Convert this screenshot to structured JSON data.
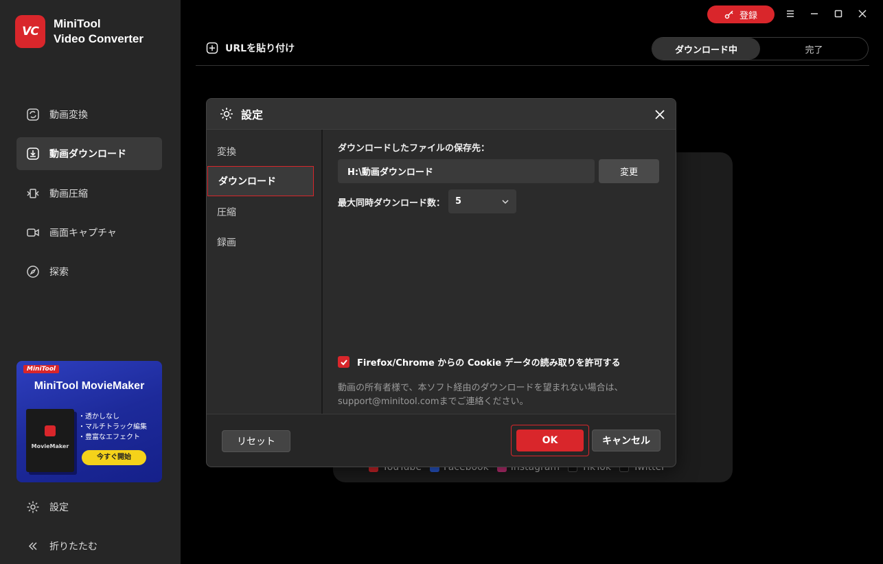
{
  "app": {
    "logo_badge": "VC",
    "logo_line1": "MiniTool",
    "logo_line2": "Video Converter"
  },
  "sidebar": {
    "items": [
      {
        "label": "動画変換",
        "icon": "convert-icon"
      },
      {
        "label": "動画ダウンロード",
        "icon": "download-icon",
        "active": true
      },
      {
        "label": "動画圧縮",
        "icon": "compress-icon"
      },
      {
        "label": "画面キャプチャ",
        "icon": "camera-icon"
      },
      {
        "label": "探索",
        "icon": "compass-icon"
      }
    ],
    "settings_label": "設定",
    "collapse_label": "折りたたむ"
  },
  "promo": {
    "tag": "MiniTool",
    "title": "MiniTool MovieMaker",
    "box_title": "MovieMaker",
    "features": [
      "・透かしなし",
      "・マルチトラック編集",
      "・豊富なエフェクト"
    ],
    "cta": "今すぐ開始"
  },
  "topbar": {
    "register_label": "登録",
    "paste_url_label": "URLを貼り付け",
    "tabs": [
      {
        "label": "ダウンロード中",
        "active": true
      },
      {
        "label": "完了"
      }
    ]
  },
  "platforms": [
    "YouTube",
    "Facebook",
    "Instagram",
    "TikTok",
    "Twitter"
  ],
  "dialog": {
    "title": "設定",
    "nav": [
      {
        "label": "変換"
      },
      {
        "label": "ダウンロード",
        "active": true
      },
      {
        "label": "圧縮"
      },
      {
        "label": "録画"
      }
    ],
    "save_location_label": "ダウンロードしたファイルの保存先：",
    "save_path": "H:\\動画ダウンロード",
    "change_button": "変更",
    "max_downloads_label": "最大同時ダウンロード数：",
    "max_downloads_value": "5",
    "cookie_label": "Firefox/Chrome からの Cookie データの読み取りを許可する",
    "cookie_checked": true,
    "note_line1": "動画の所有者様で、本ソフト経由のダウンロードを望まれない場合は、",
    "note_line2": "support@minitool.comまでご連絡ください。",
    "reset_button": "リセット",
    "ok_button": "OK",
    "cancel_button": "キャンセル"
  },
  "colors": {
    "accent": "#d9262b",
    "sidebar_bg": "#262626",
    "dialog_bg": "#2b2b2b"
  }
}
